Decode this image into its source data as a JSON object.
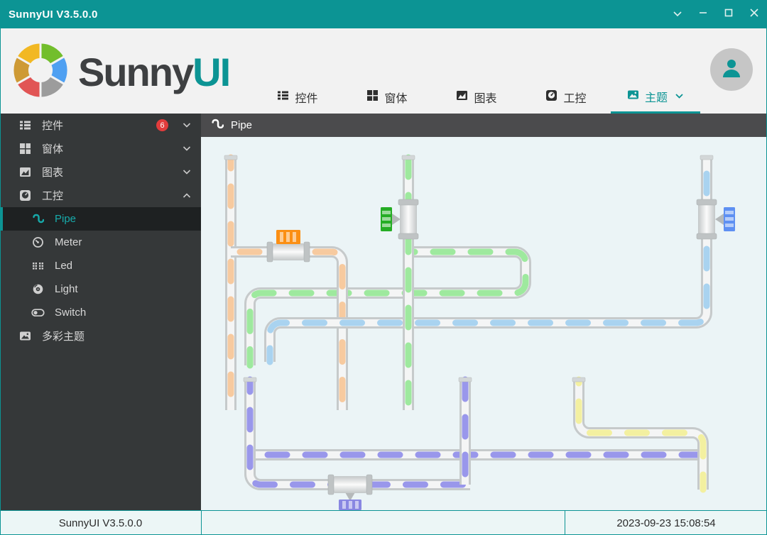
{
  "window": {
    "title": "SunnyUI V3.5.0.0",
    "controls": [
      {
        "name": "dropdown",
        "icon": "chevron-down-icon"
      },
      {
        "name": "minimize",
        "icon": "minimize-icon"
      },
      {
        "name": "maximize",
        "icon": "maximize-icon"
      },
      {
        "name": "close",
        "icon": "close-icon"
      }
    ]
  },
  "header": {
    "logo": {
      "part1": "Sunny",
      "part2": "UI",
      "icon": "color-wheel-logo"
    },
    "nav": [
      {
        "label": "控件",
        "icon": "list-icon",
        "active": false
      },
      {
        "label": "窗体",
        "icon": "windows-icon",
        "active": false
      },
      {
        "label": "图表",
        "icon": "chart-icon",
        "active": false
      },
      {
        "label": "工控",
        "icon": "gauge-icon",
        "active": false
      },
      {
        "label": "主题",
        "icon": "image-icon",
        "active": true,
        "chevron": "down"
      }
    ],
    "avatar_icon": "person-icon"
  },
  "sidebar": {
    "items": [
      {
        "label": "控件",
        "icon": "list-icon",
        "badge": "6",
        "chevron": "down",
        "level": 1,
        "selected": false
      },
      {
        "label": "窗体",
        "icon": "windows-icon",
        "chevron": "down",
        "level": 1,
        "selected": false
      },
      {
        "label": "图表",
        "icon": "chart-icon",
        "chevron": "down",
        "level": 1,
        "selected": false
      },
      {
        "label": "工控",
        "icon": "gauge-icon",
        "chevron": "up",
        "level": 1,
        "selected": false
      },
      {
        "label": "Pipe",
        "icon": "pipe-icon",
        "level": 2,
        "selected": true
      },
      {
        "label": "Meter",
        "icon": "meter-icon",
        "level": 2,
        "selected": false
      },
      {
        "label": "Led",
        "icon": "led-icon",
        "level": 2,
        "selected": false
      },
      {
        "label": "Light",
        "icon": "light-icon",
        "level": 2,
        "selected": false
      },
      {
        "label": "Switch",
        "icon": "switch-icon",
        "level": 2,
        "selected": false
      },
      {
        "label": "多彩主题",
        "icon": "image-icon",
        "level": 1,
        "selected": false
      }
    ]
  },
  "content": {
    "panel_title": "Pipe",
    "panel_icon": "pipe-icon",
    "diagram": "pipe network with flowing dashes",
    "pipe_flows": [
      "orange",
      "green",
      "blue",
      "purple",
      "yellow"
    ],
    "valves": [
      "orange-valve-top",
      "green-valve-left",
      "blue-valve-right",
      "purple-valve-bottom"
    ]
  },
  "statusbar": {
    "left": "SunnyUI V3.5.0.0",
    "right": "2023-09-23 15:08:54"
  },
  "colors": {
    "accent": "#0C9494",
    "accent_light": "#17ABAB",
    "sidebar_bg": "#353839",
    "sidebar_selected_bg": "#1E2122",
    "header_bg": "#F2F2F2",
    "panel_header_bg": "#4B4B4D",
    "canvas_bg": "#EBF4F6",
    "statusbar_bg": "#ECF6F6",
    "badge_red": "#E23C3C",
    "pipe_orange": "#F7CA9F",
    "pipe_green": "#9EE99E",
    "pipe_blue": "#A9D3F0",
    "pipe_purple": "#9997EB",
    "pipe_yellow": "#F3F0A0",
    "valve_orange": "#FB8F14",
    "valve_green": "#25AD25",
    "valve_blue": "#5E90F2",
    "valve_purple": "#8987E2",
    "tube_edge": "#C6CACB",
    "tube_core": "#F4F5F5"
  }
}
